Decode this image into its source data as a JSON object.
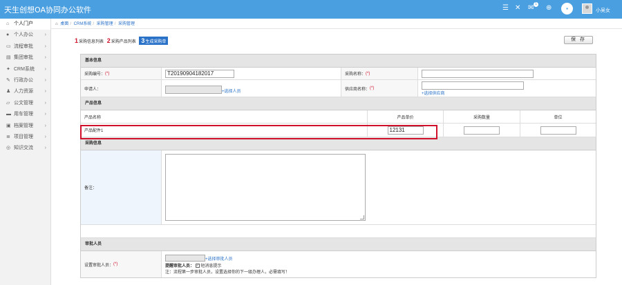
{
  "app": {
    "title": "天生创想OA协同办公软件",
    "username": "小吴女",
    "msg_badge": "1"
  },
  "colors": {
    "header": "#4a9fe0",
    "link": "#2a72c8",
    "required": "#d0102a"
  },
  "sidebar": {
    "items": [
      {
        "label": "个人门户",
        "icon": "home-icon",
        "active": true
      },
      {
        "label": "个人办公",
        "icon": "user-icon"
      },
      {
        "label": "流程审批",
        "icon": "folder-icon"
      },
      {
        "label": "集团审批",
        "icon": "document-icon"
      },
      {
        "label": "CRM系统",
        "icon": "group-icon"
      },
      {
        "label": "行政办公",
        "icon": "edit-icon"
      },
      {
        "label": "人力资源",
        "icon": "person-icon"
      },
      {
        "label": "公文管理",
        "icon": "folder-open-icon"
      },
      {
        "label": "用车管理",
        "icon": "car-icon"
      },
      {
        "label": "档案管理",
        "icon": "briefcase-icon"
      },
      {
        "label": "项目管理",
        "icon": "list-icon"
      },
      {
        "label": "知识交流",
        "icon": "globe-icon"
      }
    ]
  },
  "breadcrumb": {
    "home": "桌面",
    "items": [
      "CRM系统",
      "采购管理",
      "采购管理"
    ]
  },
  "steps": [
    {
      "num": "1",
      "label": "采购信息列表"
    },
    {
      "num": "2",
      "label": "采购产品列表"
    },
    {
      "num": "3",
      "label": "生成采购单"
    }
  ],
  "toolbar": {
    "save_label": "保 存"
  },
  "form": {
    "basic": {
      "title": "基本信息",
      "purchase_no_label": "采购编号：",
      "purchase_no_value": "T20190904182017",
      "purchase_name_label": "采购名称：",
      "purchase_name_value": "",
      "applicant_label": "申请人：",
      "applicant_value": "",
      "select_person": "+选择人员",
      "supplier_label": "供应商名称：",
      "supplier_value": "",
      "select_supplier": "+选择供应商",
      "required_mark": "(*)"
    },
    "product": {
      "title": "产品信息",
      "columns": [
        "产品名称",
        "产品单价",
        "采购数量",
        "单位"
      ],
      "rows": [
        {
          "name": "产品配件1",
          "price": "12131",
          "qty": "",
          "unit": ""
        }
      ]
    },
    "purchase": {
      "title": "采购信息",
      "note_label": "备注：",
      "note_value": ""
    },
    "approval": {
      "title": "审批人员",
      "approver_label": "设置审批人员：",
      "approver_value": "",
      "select_approver": "+选择审批人员",
      "remind_label": "提醒审批人员：",
      "remind_option": "短消息提示",
      "note": "注：流程第一步审批人员，设置选择你的下一级办理人，必需填写！"
    }
  }
}
